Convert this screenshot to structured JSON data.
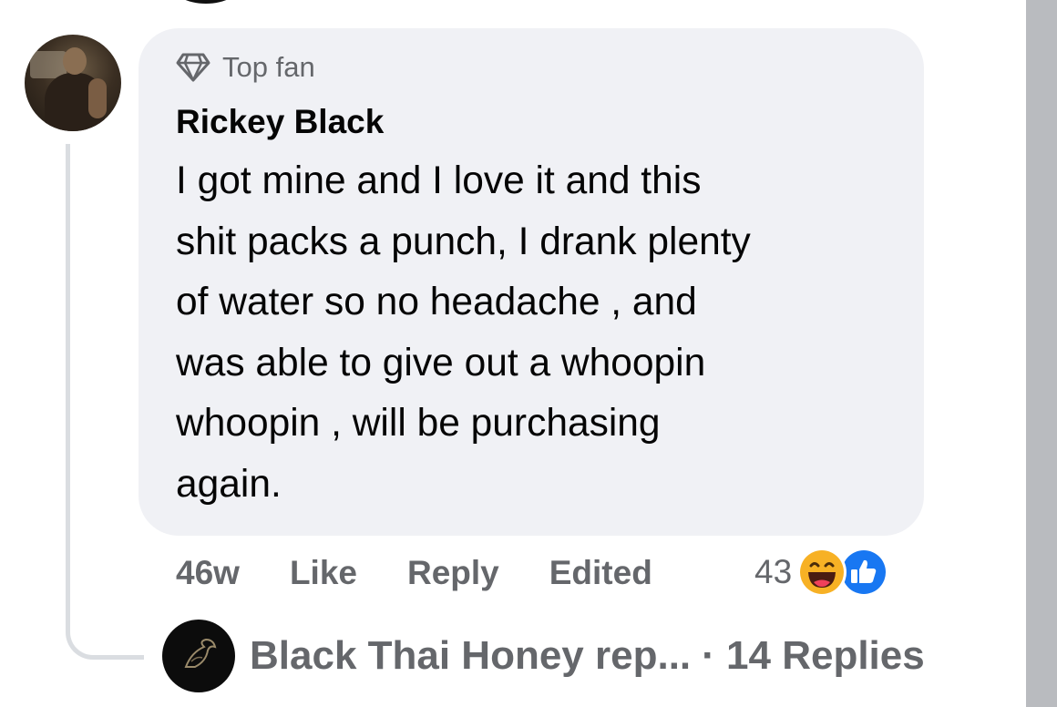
{
  "comment": {
    "badge_label": "Top fan",
    "badge_icon": "diamond-icon",
    "author": "Rickey Black",
    "lines": [
      "I got mine and I love it and this",
      "shit packs a punch, I drank plenty",
      "of water so no headache , and",
      "was able to give out a whoopin",
      "whoopin , will be purchasing",
      "again."
    ],
    "time": "46w",
    "like_label": "Like",
    "reply_label": "Reply",
    "edited_label": "Edited",
    "reaction_count": "43",
    "reaction_icons": [
      "haha-reaction-icon",
      "like-reaction-icon"
    ]
  },
  "reply_preview": {
    "name": "Black Thai Honey rep...",
    "count_text": "· 14 Replies"
  },
  "colors": {
    "bubble_bg": "#f0f1f5",
    "secondary_text": "#65676b",
    "primary_text": "#050505",
    "like_blue": "#1877f2",
    "haha_yellow": "#f7b125"
  }
}
